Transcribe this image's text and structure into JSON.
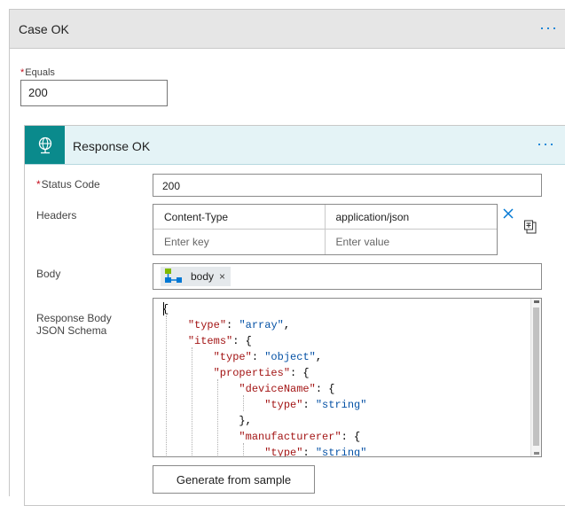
{
  "case": {
    "title": "Case OK",
    "more_label": "···",
    "equals_label": "Equals",
    "equals_value": "200"
  },
  "response": {
    "title": "Response OK",
    "more_label": "···",
    "icon": "globe-response-icon",
    "status_code_label": "Status Code",
    "status_code_value": "200",
    "headers_label": "Headers",
    "headers": [
      {
        "key": "Content-Type",
        "value": "application/json"
      }
    ],
    "header_key_placeholder": "Enter key",
    "header_value_placeholder": "Enter value",
    "body_label": "Body",
    "body_token": {
      "label": "body",
      "remove": "×",
      "icon": "dynamic-content-icon"
    },
    "schema_label": "Response Body JSON Schema",
    "schema_lines": [
      "{",
      "    \"type\": \"array\",",
      "    \"items\": {",
      "        \"type\": \"object\",",
      "        \"properties\": {",
      "            \"deviceName\": {",
      "                \"type\": \"string\"",
      "            },",
      "            \"manufacturerer\": {",
      "                \"type\": \"string\""
    ],
    "generate_button_label": "Generate from sample"
  },
  "colors": {
    "accent": "#0078d4",
    "connector_teal": "#0a8a8c",
    "header_tint": "#e4f3f6",
    "json_key": "#a31515",
    "json_string": "#0451a5",
    "required": "#c50f1f"
  }
}
